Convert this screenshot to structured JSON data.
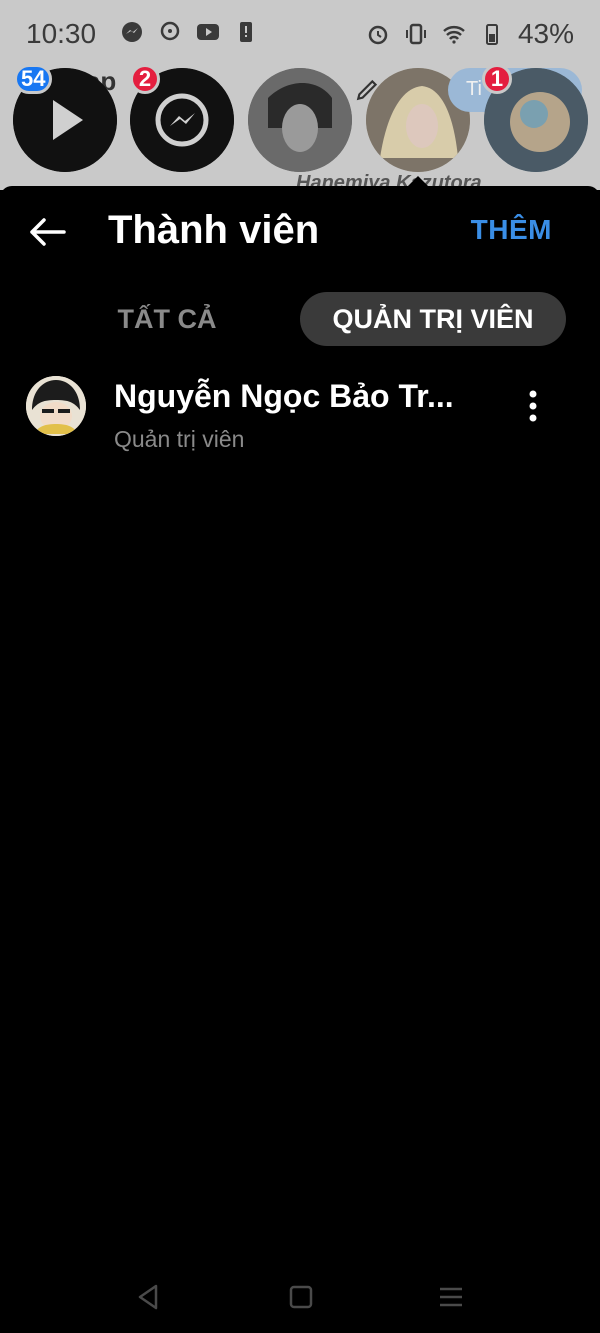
{
  "status_bar": {
    "time": "10:30",
    "battery": "43%",
    "left_icons": [
      "messenger-icon",
      "chat-heads-icon",
      "youtube-icon",
      "phone-notification-icon"
    ],
    "right_icons": [
      "alarm-icon",
      "vibrate-icon",
      "wifi-icon",
      "battery-icon"
    ]
  },
  "background": {
    "title_fragment": "hap",
    "subtitle_fragment": "Hanemiya Kazutora",
    "badges": {
      "play": "54",
      "messenger": "2",
      "story": "1"
    },
    "story_chip_fragment": "Ti"
  },
  "header": {
    "title": "Thành viên",
    "add_label": "THÊM"
  },
  "tabs": [
    {
      "label": "TẤT CẢ",
      "selected": false
    },
    {
      "label": "QUẢN TRỊ VIÊN",
      "selected": true
    }
  ],
  "members": [
    {
      "name": "Nguyễn Ngọc Bảo Tr...",
      "role": "Quản trị viên"
    }
  ],
  "colors": {
    "accent": "#3a8ee6",
    "badge_blue": "#1877f2",
    "badge_red": "#e41e3f",
    "tab_selected_bg": "#3a3a3a",
    "muted_text": "#8a8a8a"
  }
}
